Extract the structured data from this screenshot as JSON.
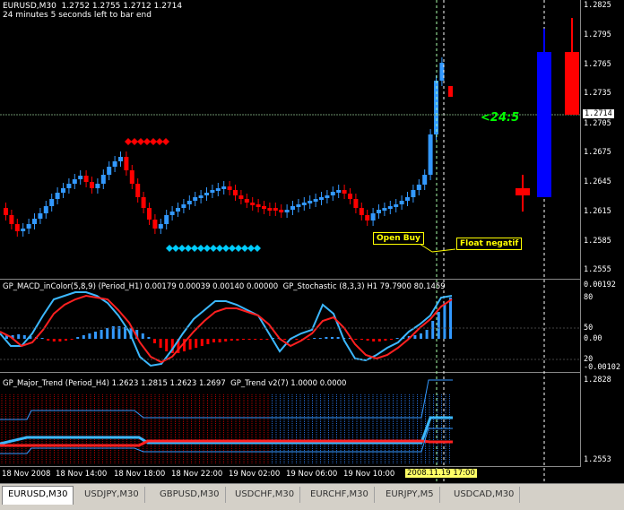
{
  "chart_info": {
    "symbol_line": "EURUSD,M30  1.2752 1.2755 1.2712 1.2714",
    "timer_line": "24 minutes 5 seconds left to bar end"
  },
  "current_price": "1.2714",
  "countdown": "<24:5",
  "main_axis": [
    "1.2825",
    "1.2795",
    "1.2765",
    "1.2735",
    "1.2705",
    "1.2675",
    "1.2645",
    "1.2615",
    "1.2585",
    "1.2555"
  ],
  "annotations": {
    "open_buy": "Open Buy",
    "float_negatif": "Float negatif"
  },
  "indicator1": {
    "title": "GP_MACD_inColor(5,8,9) (Period_H1) 0.00179 0.00039 0.00140 0.00000  GP_Stochastic (8,3,3) H1 79.7900 80.1459",
    "axis": [
      "0.00192",
      "80",
      "50",
      "0.00",
      "20",
      "-0.00102"
    ]
  },
  "indicator2": {
    "title": "GP_Major_Trend (Period_H4) 1.2623 1.2815 1.2623 1.2697  GP_Trend v2(7) 1.0000 0.0000",
    "axis": [
      "1.2828",
      "1.2553"
    ]
  },
  "time_axis": [
    "18 Nov 2008",
    "18 Nov 14:00",
    "18 Nov 18:00",
    "18 Nov 22:00",
    "19 Nov 02:00",
    "19 Nov 06:00",
    "19 Nov 10:00"
  ],
  "time_highlight": "2008.11.19 17:00",
  "tabs": [
    "EURUSD,M30",
    "USDJPY,M30",
    "GBPUSD,M30",
    "USDCHF,M30",
    "EURCHF,M30",
    "EURJPY,M5",
    "USDCAD,M30"
  ],
  "colors": {
    "bull": "#3399ff",
    "bear": "#ff0000",
    "highlight": "#ccff00",
    "countdown": "#00ff00"
  }
}
